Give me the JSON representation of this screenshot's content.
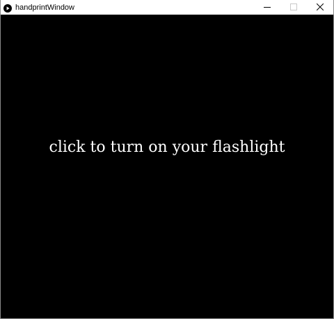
{
  "window": {
    "title": "handprintWindow",
    "app_icon": "play-circle-icon",
    "controls": {
      "minimize_icon": "minimize-icon",
      "maximize_icon": "maximize-icon",
      "close_icon": "close-icon"
    }
  },
  "canvas": {
    "background": "#000000",
    "text_color": "#ffffff",
    "message": "click to turn on your flashlight"
  }
}
